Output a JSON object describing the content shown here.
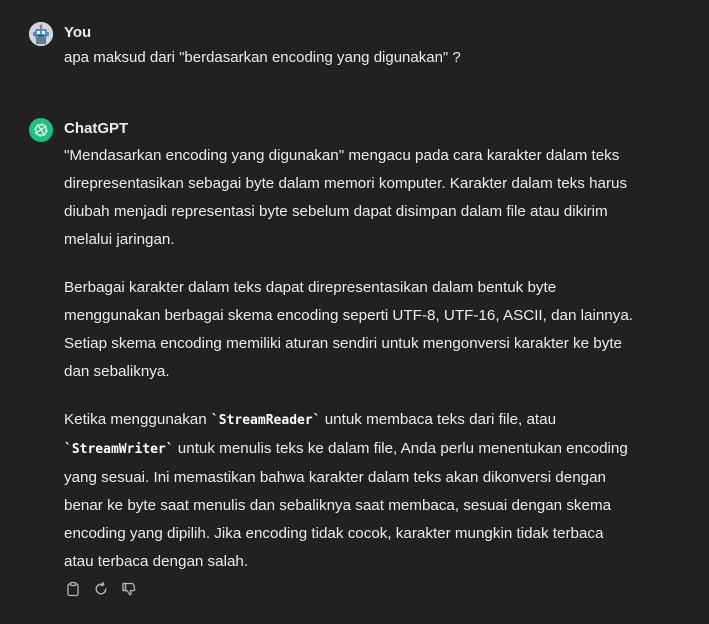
{
  "user_message": {
    "author": "You",
    "text": "apa maksud dari \"berdasarkan encoding yang digunakan\" ?",
    "avatar_icon": "user-avatar-robot"
  },
  "assistant_message": {
    "author": "ChatGPT",
    "avatar_icon": "openai-logo-icon",
    "p1": {
      "l1": "\"Mendasarkan encoding yang digunakan\" mengacu pada cara karakter dalam teks",
      "l2": "direpresentasikan sebagai byte dalam memori komputer. Karakter dalam teks harus",
      "l3": "diubah menjadi representasi byte sebelum dapat disimpan dalam file atau dikirim",
      "l4": "melalui jaringan."
    },
    "p2": {
      "l1": "Berbagai karakter dalam teks dapat direpresentasikan dalam bentuk byte",
      "l2": "menggunakan berbagai skema encoding seperti UTF-8, UTF-16, ASCII, dan lainnya.",
      "l3": "Setiap skema encoding memiliki aturan sendiri untuk mengonversi karakter ke byte",
      "l4": "dan sebaliknya."
    },
    "p3": {
      "l1_pre": "Ketika menggunakan ",
      "code1": "`StreamReader`",
      "l1_post": " untuk membaca teks dari file, atau",
      "code2": "`StreamWriter`",
      "l2_post": " untuk menulis teks ke dalam file, Anda perlu menentukan encoding",
      "l3": "yang sesuai. Ini memastikan bahwa karakter dalam teks akan dikonversi dengan",
      "l4": "benar ke byte saat menulis dan sebaliknya saat membaca, sesuai dengan skema",
      "l5": "encoding yang dipilih. Jika encoding tidak cocok, karakter mungkin tidak terbaca",
      "l6": "atau terbaca dengan salah."
    },
    "actions": [
      "clipboard-icon",
      "regenerate-icon",
      "thumbs-down-icon"
    ]
  },
  "colors": {
    "background": "#212121",
    "text": "#ececec",
    "icon": "#b4b4b4",
    "gpt_avatar": "#19c37d"
  }
}
